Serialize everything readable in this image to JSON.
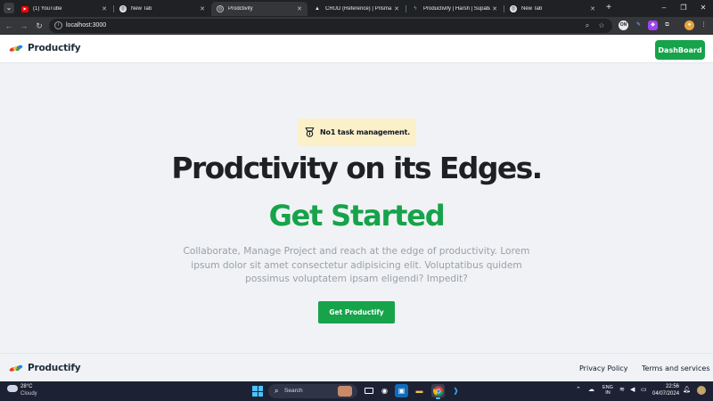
{
  "browser": {
    "tabs": [
      {
        "title": "(1) YouTube",
        "icon": "youtube-icon"
      },
      {
        "title": "New Tab",
        "icon": "chrome-icon"
      },
      {
        "title": "Prodctivify",
        "icon": "globe-icon"
      },
      {
        "title": "CRUD (Reference) | Prisma Doc",
        "icon": "prisma-icon"
      },
      {
        "title": "Productivify | Harsh | Supabase",
        "icon": "supabase-icon"
      },
      {
        "title": "New Tab",
        "icon": "chrome-icon"
      }
    ],
    "url": "localhost:3000",
    "profile_badge": "ON"
  },
  "app": {
    "brand": "Productify",
    "dashboard_button": "DashBoard",
    "badge_text": "No1 task management.",
    "hero_title": "Prodctivity on its Edges.",
    "hero_subtitle": "Get Started",
    "hero_description": "Collaborate, Manage Project and reach at the edge of productivity. Lorem ipsum dolor sit amet consectetur adipisicing elit. Voluptatibus quidem possimus voluptatem ipsam eligendi? Impedit?",
    "cta_button": "Get Productify",
    "footer": {
      "brand": "Productify",
      "links": [
        "Privacy Policy",
        "Terms and services"
      ]
    },
    "colors": {
      "accent": "#16a34a",
      "badge_bg": "#fcf0c8",
      "page_bg": "#f0f2f5"
    }
  },
  "taskbar": {
    "weather_temp": "28°C",
    "weather_desc": "Cloudy",
    "search_placeholder": "Search",
    "lang_top": "ENG",
    "lang_bottom": "IN",
    "time": "22:56",
    "date": "04/07/2024"
  }
}
